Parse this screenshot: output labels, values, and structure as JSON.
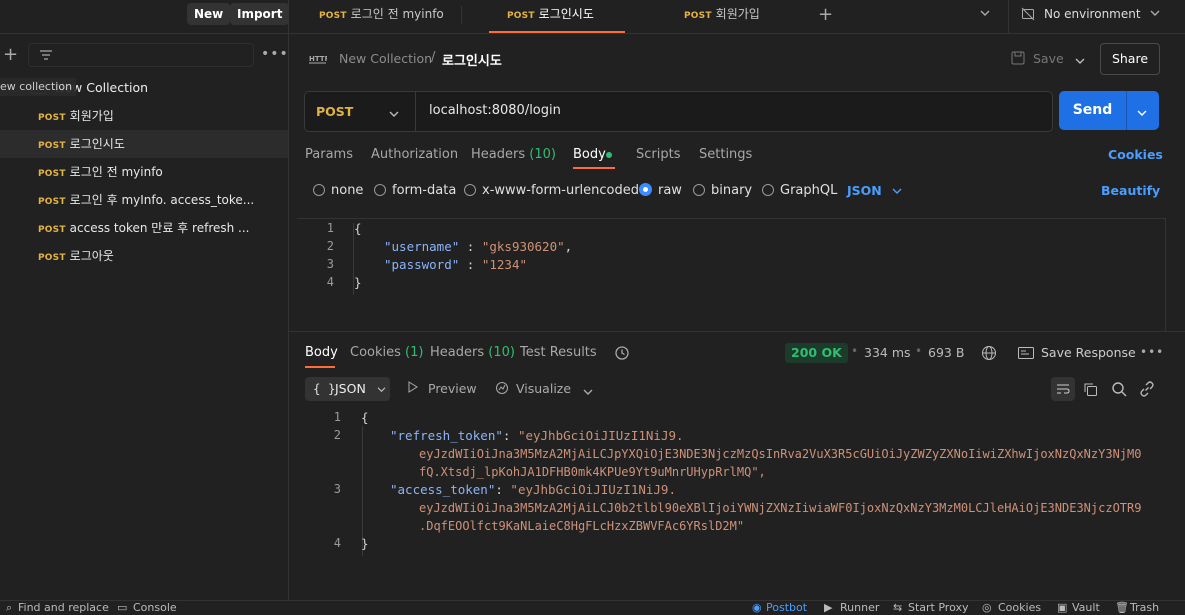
{
  "topbar": {
    "new_label": "New",
    "import_label": "Import",
    "tabs": [
      {
        "method": "POST",
        "name": "로그인 전 myinfo"
      },
      {
        "method": "POST",
        "name": "로그인시도"
      },
      {
        "method": "POST",
        "name": "회원가입"
      }
    ],
    "environment": "No environment"
  },
  "sidebar": {
    "tooltip": "ew collection",
    "collection_name": "New Collection",
    "items": [
      {
        "method": "POST",
        "name": "회원가입"
      },
      {
        "method": "POST",
        "name": "로그인시도"
      },
      {
        "method": "POST",
        "name": "로그인 전 myinfo"
      },
      {
        "method": "POST",
        "name": "로그인 후 myInfo. access_toke..."
      },
      {
        "method": "POST",
        "name": "access token 만료 후 refresh ..."
      },
      {
        "method": "POST",
        "name": "로그아웃"
      }
    ]
  },
  "request": {
    "breadcrumb_collection": "New Collection",
    "breadcrumb_sep": "/",
    "breadcrumb_request": "로그인시도",
    "save_label": "Save",
    "share_label": "Share",
    "method": "POST",
    "url": "localhost:8080/login",
    "send_label": "Send",
    "tabs": {
      "params": "Params",
      "authorization": "Authorization",
      "headers": "Headers",
      "headers_count": "(10)",
      "body": "Body",
      "scripts": "Scripts",
      "settings": "Settings"
    },
    "cookies_link": "Cookies",
    "body_types": [
      "none",
      "form-data",
      "x-www-form-urlencoded",
      "raw",
      "binary",
      "GraphQL"
    ],
    "body_format": "JSON",
    "beautify_label": "Beautify",
    "body_lines": {
      "n1": "1",
      "n2": "2",
      "n3": "3",
      "n4": "4",
      "open": "{",
      "k1": "\"username\"",
      "c1": " : ",
      "v1": "\"gks930620\"",
      "t1": ",",
      "k2": "\"password\"",
      "c2": " : ",
      "v2": "\"1234\"",
      "close": "}"
    }
  },
  "response": {
    "tabs": {
      "body": "Body",
      "cookies": "Cookies",
      "cookies_count": "(1)",
      "headers": "Headers",
      "headers_count": "(10)",
      "test_results": "Test Results"
    },
    "status": "200 OK",
    "time": "334 ms",
    "size": "693 B",
    "save_response": "Save Response",
    "view_format": "JSON",
    "preview_label": "Preview",
    "visualize_label": "Visualize",
    "lines": {
      "n1": "1",
      "n2": "2",
      "n3": "3",
      "n4": "4",
      "open": "{",
      "k1": "\"refresh_token\"",
      "c1": ": ",
      "v1a": "\"eyJhbGciOiJIUzI1NiJ9.",
      "v1b": "eyJzdWIiOiJna3M5MzA2MjAiLCJpYXQiOjE3NDE3NjczMzQsInRva2VuX3R5cGUiOiJyZWZyZXNoIiwiZXhwIjoxNzQxNzY3NjM0",
      "v1c": "fQ.Xtsdj_lpKohJA1DFHB0mk4KPUe9Yt9uMnrUHypRrlMQ\",",
      "k2": "\"access_token\"",
      "c2": ": ",
      "v2a": "\"eyJhbGciOiJIUzI1NiJ9.",
      "v2b": "eyJzdWIiOiJna3M5MzA2MjAiLCJ0b2tlbl90eXBlIjoiYWNjZXNzIiwiaWF0IjoxNzQxNzY3MzM0LCJleHAiOjE3NDE3NjczOTR9",
      "v2c": ".DqfEOOlfct9KaNLaieC8HgFLcHzxZBWVFAc6YRslD2M\"",
      "close": "}"
    }
  },
  "statusbar": {
    "find_replace": "Find and replace",
    "console": "Console",
    "postbot": "Postbot",
    "runner": "Runner",
    "start_proxy": "Start Proxy",
    "cookies": "Cookies",
    "vault": "Vault",
    "trash": "Trash"
  },
  "colors": {
    "accent": "#ff6c37",
    "send": "#1f6fe5",
    "method_post": "#e3b341",
    "status_ok": "#2fbf71",
    "link": "#4a9eff"
  }
}
